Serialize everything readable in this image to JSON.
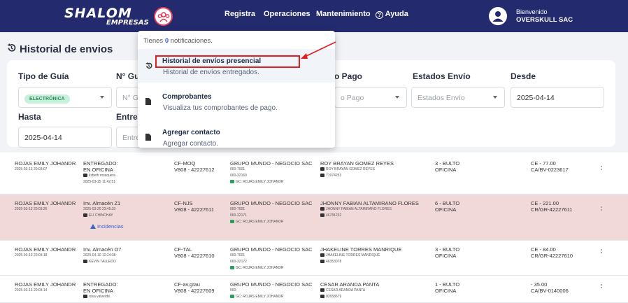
{
  "brand": {
    "name": "SHALOM",
    "sub": "EMPRESAS"
  },
  "nav": {
    "registra": "Registra",
    "operaciones": "Operaciones",
    "mantenimiento": "Mantenimiento",
    "ayuda": "Ayuda"
  },
  "user": {
    "greeting": "Bienvenido",
    "company": "OVERSKULL SAC"
  },
  "page": {
    "title": "Historial de envios"
  },
  "filters": {
    "tipo_guia": {
      "label": "Tipo de Guía",
      "value": "ELECTRÓNICA"
    },
    "n_guia": {
      "label": "N° Gu",
      "placeholder": "N° G"
    },
    "pago": {
      "label": "o Pago",
      "placeholder": "o Pago"
    },
    "estados": {
      "label": "Estados Envío",
      "placeholder": "Estados Envío"
    },
    "desde": {
      "label": "Desde",
      "value": "2025-04-14"
    },
    "hasta": {
      "label": "Hasta",
      "value": "2025-04-14"
    },
    "entrega": {
      "label": "Entreg",
      "placeholder": "Entreg"
    }
  },
  "dropdown": {
    "notif_prefix": "Tienes",
    "notif_count": "0",
    "notif_suffix": "notificaciones.",
    "items": [
      {
        "title": "Historial de envíos presencial",
        "subtitle": "Historial de envíos entregados."
      },
      {
        "title": "Comprobantes",
        "subtitle": "Visualiza tus comprobantes de pago."
      },
      {
        "title": "Agregar contacto",
        "subtitle": "Agregar contacto."
      }
    ]
  },
  "rows": [
    {
      "sender": "ROJAS EMILY JOHANDR",
      "sender_date": "2025-03-13 20:03:07",
      "status1": "ENTREGADO:",
      "status2": "EN OFICINA",
      "status_user": "lizbeth mosquera",
      "status_date": "2025-03-15 11:42:51",
      "guide1": "CF-MOQ",
      "guide2": "V808 - 42227612",
      "company": "GRUPO MUNDO - NEGOCIO SAC",
      "code1": "000-7001",
      "code2": "000-32169",
      "gc": "GC: ROJAS EMILY JOHANDR",
      "receiver": "ROY BRAYAN GOMEZ REYES",
      "receiver_sub": "ROY BRAYAN GOMEZ REYES",
      "receiver_doc": "71974253",
      "qty": "3 - BULTO",
      "qty2": "OFICINA",
      "amount": "CE - 77.00",
      "doc": "CA/BV-0223617"
    },
    {
      "sender": "ROJAS EMILY JOHANDR",
      "sender_date": "2025-03-13 20:03:26",
      "status1": "Inv. Almacén Z1",
      "status2": "2025-03-20 23:45:33",
      "status_user": "ELI CHINCHAY",
      "incidencias": "Incidencias",
      "guide1": "CF-NJS",
      "guide2": "V808 - 42227611",
      "company": "GRUPO MUNDO - NEGOCIO SAC",
      "code1": "000-7001",
      "code2": "000-32171",
      "gc": "GC: ROJAS EMILY JOHANDR",
      "receiver": "JHONNY FABIAN ALTAMIRANO FLORES",
      "receiver_sub": "JHONNY FABIAN ALTAMIRANO FLORES",
      "receiver_doc": "46781232",
      "qty": "6 - BULTO",
      "qty2": "OFICINA",
      "amount": "CE - 221.00",
      "doc": "CR/GR-42227611"
    },
    {
      "sender": "ROJAS EMILY JOHANDR",
      "sender_date": "2025-03-13 20:03:18",
      "status1": "Inv. Almacén O7",
      "status2": "2025-04-10 12:24:38",
      "status_user": "KEVIN TALLEDO",
      "guide1": "CF-TAL",
      "guide2": "V808 - 42227610",
      "company": "GRUPO MUNDO - NEGOCIO SAC",
      "code1": "000-7001",
      "code2": "000-32172",
      "gc": "GC: ROJAS EMILY JOHANDR",
      "receiver": "JHAKELINE TORRES MANRIQUE",
      "receiver_sub": "JHAKELINE TORRES MANRIQUE",
      "receiver_doc": "46353078",
      "qty": "3 - BULTO",
      "qty2": "OFICINA",
      "amount": "CE - 84.00",
      "doc": "CR/GR-42227610"
    },
    {
      "sender": "ROJAS EMILY JOHANDR",
      "sender_date": "2025-03-13 20:03:14",
      "status1": "ENTREGADO:",
      "status2": "EN OFICINA",
      "status_user": "rosa valverde",
      "guide1": "CF-av.grau",
      "guide2": "V808 - 42227609",
      "company": "GRUPO MUNDO - NEGOCIO SAC",
      "code1": "000-",
      "code2": "",
      "gc": "GC: ROJAS EMILY JOHANDR",
      "receiver": "CESAR ARANDA PANTA",
      "receiver_sub": "CESAR ARANDA PANTA",
      "receiver_doc": "02658679",
      "qty": "1 - BULTO",
      "qty2": "OFICINA",
      "amount": "- 35.00",
      "doc": "CA/BV-0140006"
    }
  ]
}
